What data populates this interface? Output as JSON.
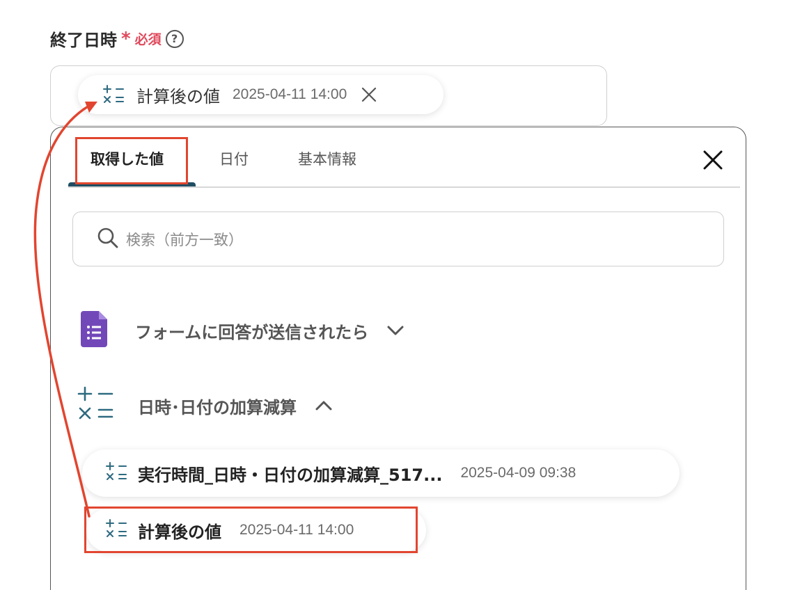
{
  "field": {
    "label": "終了日時",
    "required_mark": "*",
    "required_text": "必須",
    "help_symbol": "?"
  },
  "selected_chip": {
    "label": "計算後の値",
    "value": "2025-04-11 14:00",
    "icon": "calculator-icon"
  },
  "tabs": [
    {
      "label": "取得した値",
      "active": true
    },
    {
      "label": "日付",
      "active": false
    },
    {
      "label": "基本情報",
      "active": false
    }
  ],
  "search": {
    "placeholder": "検索（前方一致）"
  },
  "sections": {
    "forms": {
      "title": "フォームに回答が送信されたら",
      "icon": "google-forms-icon",
      "expanded": false
    },
    "calc": {
      "title": "日時･日付の加算減算",
      "icon": "calculator-icon",
      "expanded": true
    }
  },
  "items": [
    {
      "label": "実行時間_日時・日付の加算減算_517...",
      "value": "2025-04-09 09:38"
    },
    {
      "label": "計算後の値",
      "value": "2025-04-11 14:00"
    }
  ],
  "colors": {
    "accent": "#1f4e63",
    "required": "#e0495c",
    "highlight": "#e2452f",
    "forms_purple": "#7248b9"
  }
}
